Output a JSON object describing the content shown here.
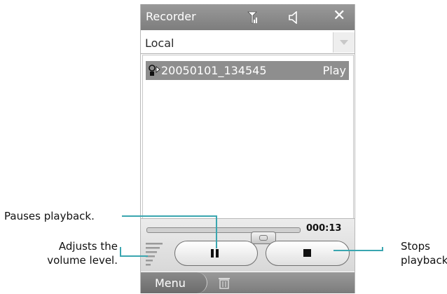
{
  "window": {
    "title": "Recorder",
    "icons": [
      "signal-antenna-icon",
      "speaker-icon",
      "close-icon"
    ]
  },
  "location": {
    "selected": "Local"
  },
  "recordings": [
    {
      "name": "20050101_134545",
      "action": "Play",
      "icon": "voice-recording-icon"
    }
  ],
  "player": {
    "time": "000:13",
    "pause_icon": "pause-icon",
    "stop_icon": "stop-icon",
    "volume_icon": "volume-bars-icon"
  },
  "softkeys": {
    "menu": "Menu",
    "delete_icon": "trash-icon"
  },
  "callouts": {
    "pause": "Pauses playback.",
    "volume_line1": "Adjusts the",
    "volume_line2": "volume level.",
    "stop_line1": "Stops",
    "stop_line2": "playback."
  },
  "colors": {
    "callout_line": "#3aa6b0",
    "title_bar": "#8a8a8a",
    "selection": "#8e8e8e"
  }
}
